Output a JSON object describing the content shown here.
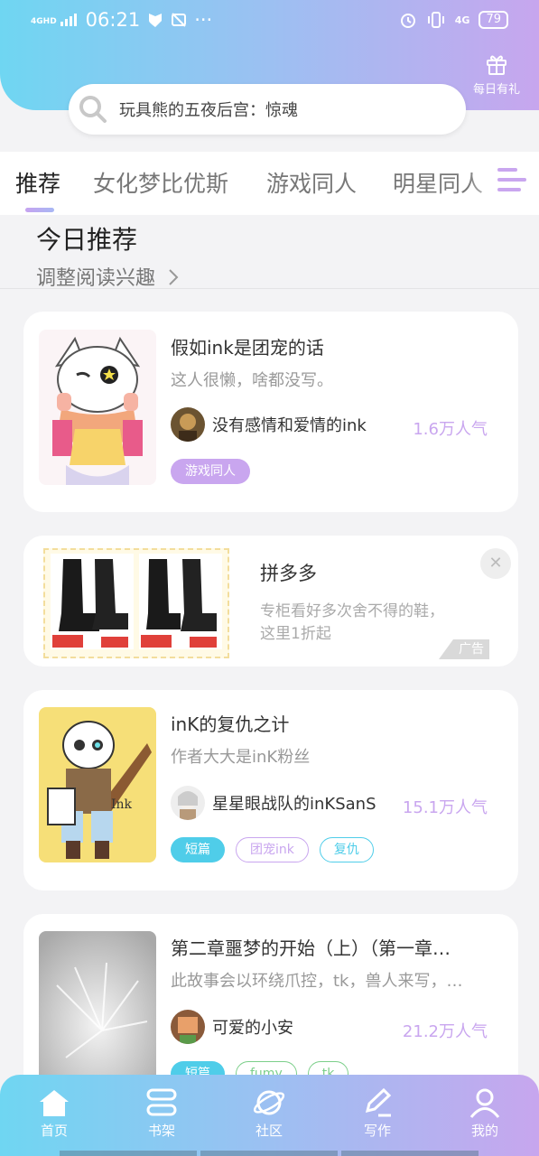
{
  "status_bar": {
    "network": "4G",
    "network_sub": "HD",
    "time": "06:21",
    "battery": "79",
    "right_network": "4G"
  },
  "gift": {
    "label": "每日有礼"
  },
  "search": {
    "placeholder": "玩具熊的五夜后宫：惊魂"
  },
  "tabs": [
    {
      "label": "推荐",
      "active": true
    },
    {
      "label": "女化梦比优斯",
      "active": false
    },
    {
      "label": "游戏同人",
      "active": false
    },
    {
      "label": "明星同人",
      "active": false
    }
  ],
  "section": {
    "title": "今日推荐",
    "subtitle": "调整阅读兴趣"
  },
  "cards": [
    {
      "title": "假如ink是团宠的话",
      "desc": "这人很懒，啥都没写。",
      "author": "没有感情和爱情的ink",
      "popularity": "1.6万人气",
      "tags": [
        "游戏同人"
      ]
    },
    {
      "title": "inK的复仇之计",
      "desc": "作者大大是inK粉丝",
      "author": "星星眼战队的inKSanS",
      "popularity": "15.1万人气",
      "tags": [
        "短篇",
        "团宠ink",
        "复仇"
      ]
    },
    {
      "title": "第二章噩梦的开始（上）（第一章…",
      "desc": "此故事会以环绕爪控，tk，兽人来写，…",
      "author": "可爱的小安",
      "popularity": "21.2万人气",
      "tags": [
        "短篇",
        "fumy",
        "tk"
      ]
    }
  ],
  "ad": {
    "title": "拼多多",
    "desc": "专柜看好多次舍不得的鞋，这里1折起",
    "badge": "广告"
  },
  "bottom_nav": [
    {
      "label": "首页",
      "icon": "home-icon",
      "active": true
    },
    {
      "label": "书架",
      "icon": "bookshelf-icon",
      "active": false
    },
    {
      "label": "社区",
      "icon": "planet-icon",
      "active": false
    },
    {
      "label": "写作",
      "icon": "pen-icon",
      "active": false
    },
    {
      "label": "我的",
      "icon": "user-icon",
      "active": false
    }
  ],
  "colors": {
    "accent_purple": "#c9a6ef",
    "accent_blue": "#4fcde9",
    "gradient_start": "#6fd6f2",
    "gradient_end": "#c7a6ee"
  }
}
